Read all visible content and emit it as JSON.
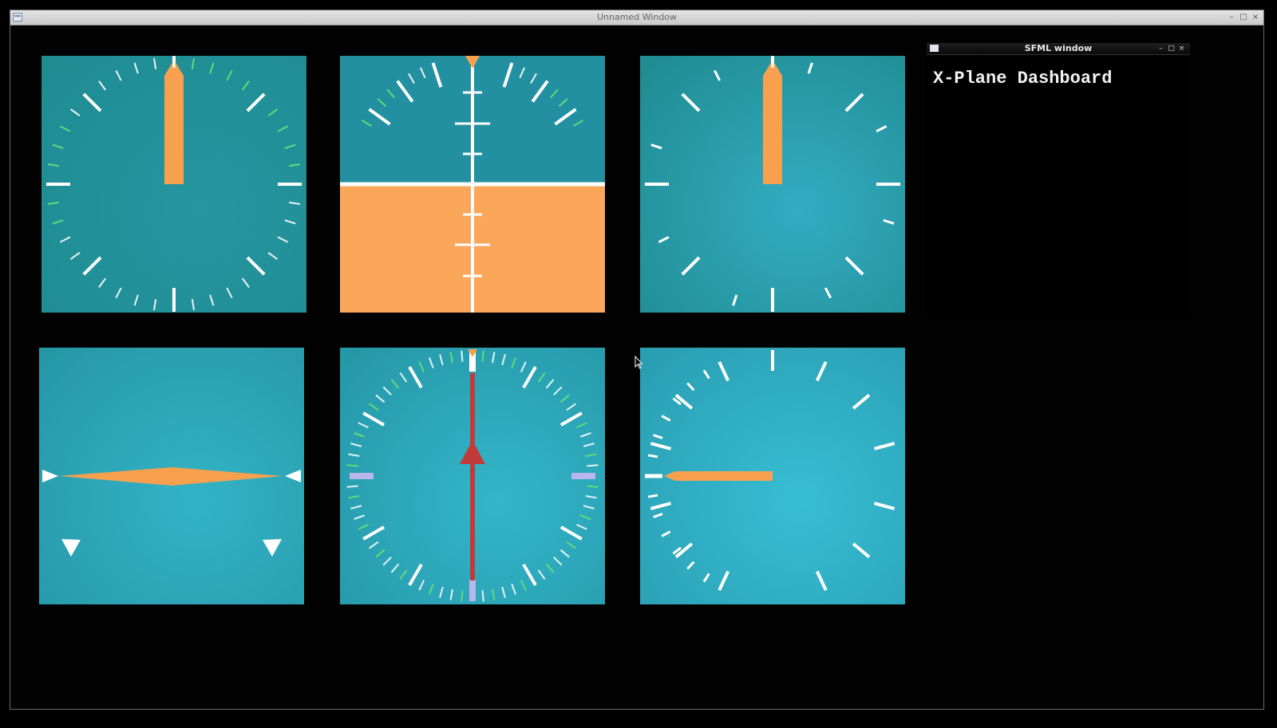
{
  "outer_window": {
    "title": "Unnamed Window",
    "buttons": {
      "minimize": "–",
      "maximize": "□",
      "close": "×"
    }
  },
  "sfml_window": {
    "title": "SFML window",
    "heading": "X-Plane Dashboard",
    "buttons": {
      "minimize": "–",
      "maximize": "□",
      "close": "×"
    }
  },
  "colors": {
    "background": "#000000",
    "gauge_face_dark": "#1f8c92",
    "gauge_face_light": "#34b6cc",
    "needle_orange": "#f7a14f",
    "ground_orange": "#fba75a",
    "tick_white": "#ffffff",
    "tick_green": "#5fdc7a",
    "red_needle": "#c23a3a",
    "lavender": "#b9b6ec"
  },
  "gauges": [
    {
      "name": "airspeed-indicator",
      "needle_icon": "orange-needle",
      "needle_angle_deg": 0
    },
    {
      "name": "attitude-indicator",
      "pitch_deg": 0,
      "roll_deg": 0,
      "bank_pointer_icon": "orange-triangle"
    },
    {
      "name": "altimeter",
      "needle_icon": "orange-needle",
      "needle_angle_deg": 0
    },
    {
      "name": "turn-coordinator",
      "wing_icon": "orange-diamond",
      "turn_rate": 0
    },
    {
      "name": "heading-indicator",
      "arrow_icon": "red-arrow",
      "heading_deg": 0
    },
    {
      "name": "vertical-speed-indicator",
      "needle_icon": "orange-needle",
      "needle_angle_deg": -90
    }
  ]
}
